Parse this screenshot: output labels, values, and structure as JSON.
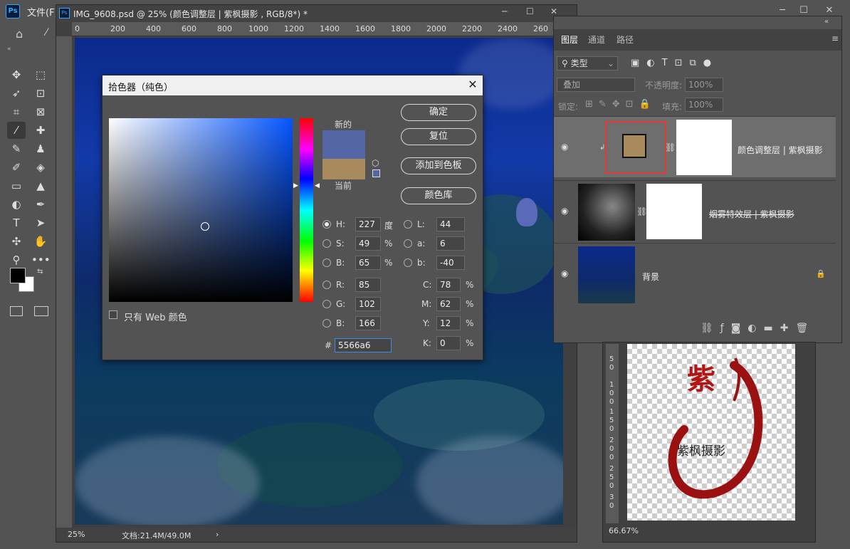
{
  "app": {
    "logo": "Ps",
    "menu_file": "文件(F)"
  },
  "document": {
    "title": "IMG_9608.psd @ 25% (颜色调整层 | 紫枫摄影 , RGB/8*) *",
    "ruler_ticks": [
      "0",
      "200",
      "400",
      "600",
      "800",
      "1000",
      "1200",
      "1400",
      "1600",
      "1800",
      "2000",
      "2200",
      "2400",
      "260"
    ],
    "zoom": "25%",
    "file_info": "文档:21.4M/49.0M",
    "status_arrow": "›"
  },
  "color_picker": {
    "title": "拾色器（纯色）",
    "close": "✕",
    "new_label": "新的",
    "current_label": "当前",
    "new_color": "#5566a6",
    "current_color": "#a88a5c",
    "buttons": {
      "ok": "确定",
      "reset": "复位",
      "add_swatch": "添加到色板",
      "library": "颜色库"
    },
    "web_only": "只有 Web 颜色",
    "fields": {
      "H": "227",
      "S": "49",
      "B": "65",
      "R": "85",
      "G": "102",
      "B2": "166",
      "L": "44",
      "a": "6",
      "b": "-40",
      "C": "78",
      "M": "62",
      "Y": "12",
      "K": "0",
      "hex": "5566a6"
    },
    "units": {
      "deg": "度",
      "pct": "%"
    },
    "labels": {
      "H": "H:",
      "S": "S:",
      "B": "B:",
      "R": "R:",
      "G": "G:",
      "B2": "B:",
      "L": "L:",
      "a": "a:",
      "b": "b:",
      "C": "C:",
      "M": "M:",
      "Y": "Y:",
      "K": "K:",
      "hash": "#"
    }
  },
  "layers_panel": {
    "tabs": [
      "图层",
      "通道",
      "路径"
    ],
    "filter": "类型",
    "blend_mode": "叠加",
    "opacity_label": "不透明度:",
    "opacity_value": "100%",
    "lock_label": "锁定:",
    "fill_label": "填充:",
    "fill_value": "100%",
    "layers": [
      {
        "name": "颜色调整层 | 紫枫摄影"
      },
      {
        "name": "烟雾特效层 | 紫枫摄影"
      },
      {
        "name": "背景"
      }
    ]
  },
  "document2": {
    "zoom": "66.67%",
    "ruler_ticks": [
      "5",
      "0",
      "1",
      "0",
      "0",
      "1",
      "5",
      "0",
      "2",
      "0",
      "0",
      "2",
      "5",
      "0",
      "3",
      "0"
    ],
    "watermark_text": "紫枫摄影"
  }
}
